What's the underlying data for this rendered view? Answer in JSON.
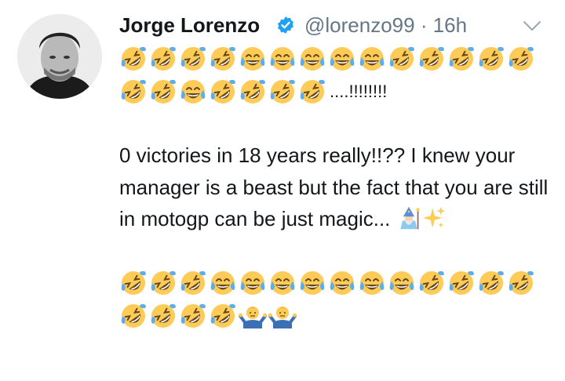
{
  "tweet": {
    "author_name": "Jorge Lorenzo",
    "handle": "@lorenzo99",
    "separator": " · ",
    "time": "16h",
    "verified_icon": "verified-badge-icon",
    "menu_icon": "chevron-down-icon",
    "accent_color": "#1da1f2",
    "line1_emojis": [
      "rolling-on-floor-laughing",
      "rolling-on-floor-laughing",
      "rolling-on-floor-laughing",
      "rolling-on-floor-laughing",
      "face-with-tears-of-joy",
      "face-with-tears-of-joy",
      "face-with-tears-of-joy",
      "face-with-tears-of-joy",
      "face-with-tears-of-joy",
      "rolling-on-floor-laughing",
      "rolling-on-floor-laughing",
      "rolling-on-floor-laughing",
      "rolling-on-floor-laughing",
      "rolling-on-floor-laughing"
    ],
    "line2_emojis": [
      "rolling-on-floor-laughing",
      "rolling-on-floor-laughing",
      "face-with-tears-of-joy",
      "rolling-on-floor-laughing",
      "rolling-on-floor-laughing",
      "rolling-on-floor-laughing",
      "rolling-on-floor-laughing"
    ],
    "line2_trailing": "....!!!!!!!!",
    "message_text": "0 victories in 18 years really!!?? I knew your manager is a beast but the fact that you are still in motogp can be just magic...",
    "message_emojis": [
      "mage",
      "sparkles"
    ],
    "line3_emojis": [
      "rolling-on-floor-laughing",
      "rolling-on-floor-laughing",
      "rolling-on-floor-laughing",
      "face-with-tears-of-joy",
      "face-with-tears-of-joy",
      "face-with-tears-of-joy",
      "face-with-tears-of-joy",
      "face-with-tears-of-joy",
      "face-with-tears-of-joy",
      "face-with-tears-of-joy",
      "rolling-on-floor-laughing",
      "rolling-on-floor-laughing",
      "rolling-on-floor-laughing",
      "rolling-on-floor-laughing"
    ],
    "line4_emojis": [
      "rolling-on-floor-laughing",
      "rolling-on-floor-laughing",
      "rolling-on-floor-laughing",
      "rolling-on-floor-laughing",
      "man-shrugging",
      "man-shrugging"
    ]
  }
}
